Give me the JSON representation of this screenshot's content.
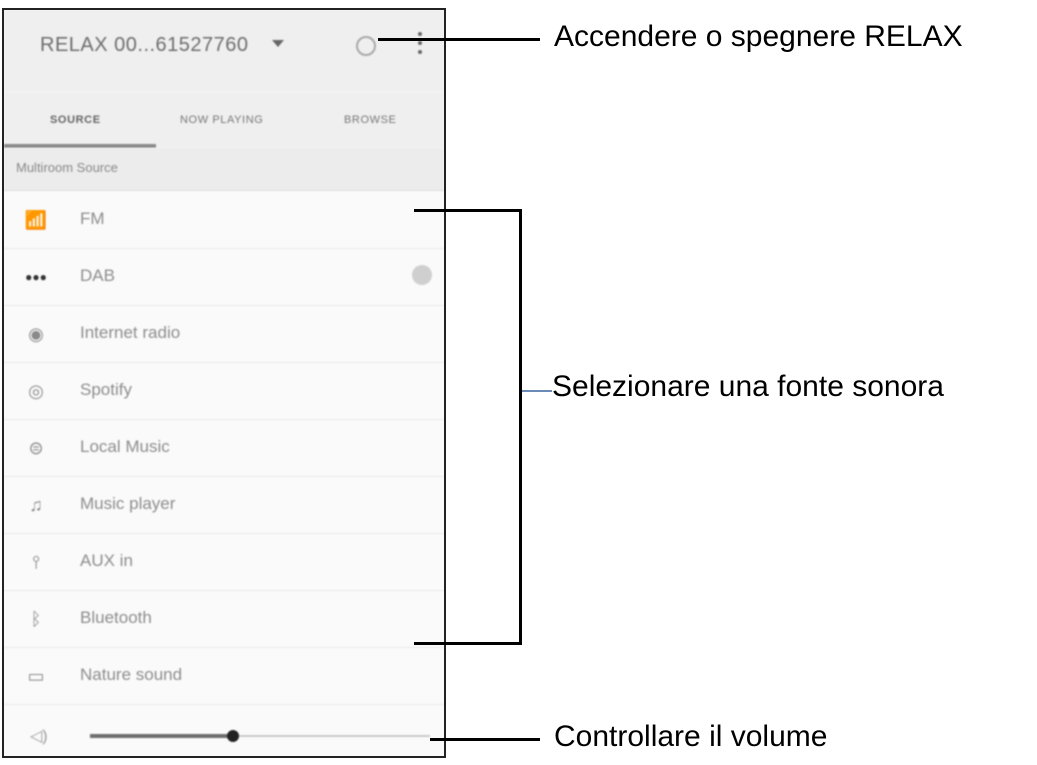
{
  "app": {
    "device_name": "RELAX 00...61527760",
    "tabs": [
      "SOURCE",
      "NOW PLAYING",
      "BROWSE"
    ],
    "section_header": "Multiroom Source"
  },
  "sources": [
    {
      "icon": "fm-icon",
      "label": "FM"
    },
    {
      "icon": "dab-icon",
      "label": "DAB"
    },
    {
      "icon": "internet-radio-icon",
      "label": "Internet radio"
    },
    {
      "icon": "spotify-icon",
      "label": "Spotify"
    },
    {
      "icon": "local-music-icon",
      "label": "Local Music"
    },
    {
      "icon": "music-player-icon",
      "label": "Music player"
    },
    {
      "icon": "aux-in-icon",
      "label": "AUX in"
    },
    {
      "icon": "bluetooth-icon",
      "label": "Bluetooth"
    },
    {
      "icon": "nature-sound-icon",
      "label": "Nature sound"
    }
  ],
  "volume": {
    "level": 0.42
  },
  "annotations": {
    "power": "Accendere o spegnere RELAX",
    "source": "Selezionare una fonte sonora",
    "volume": "Controllare il volume"
  }
}
